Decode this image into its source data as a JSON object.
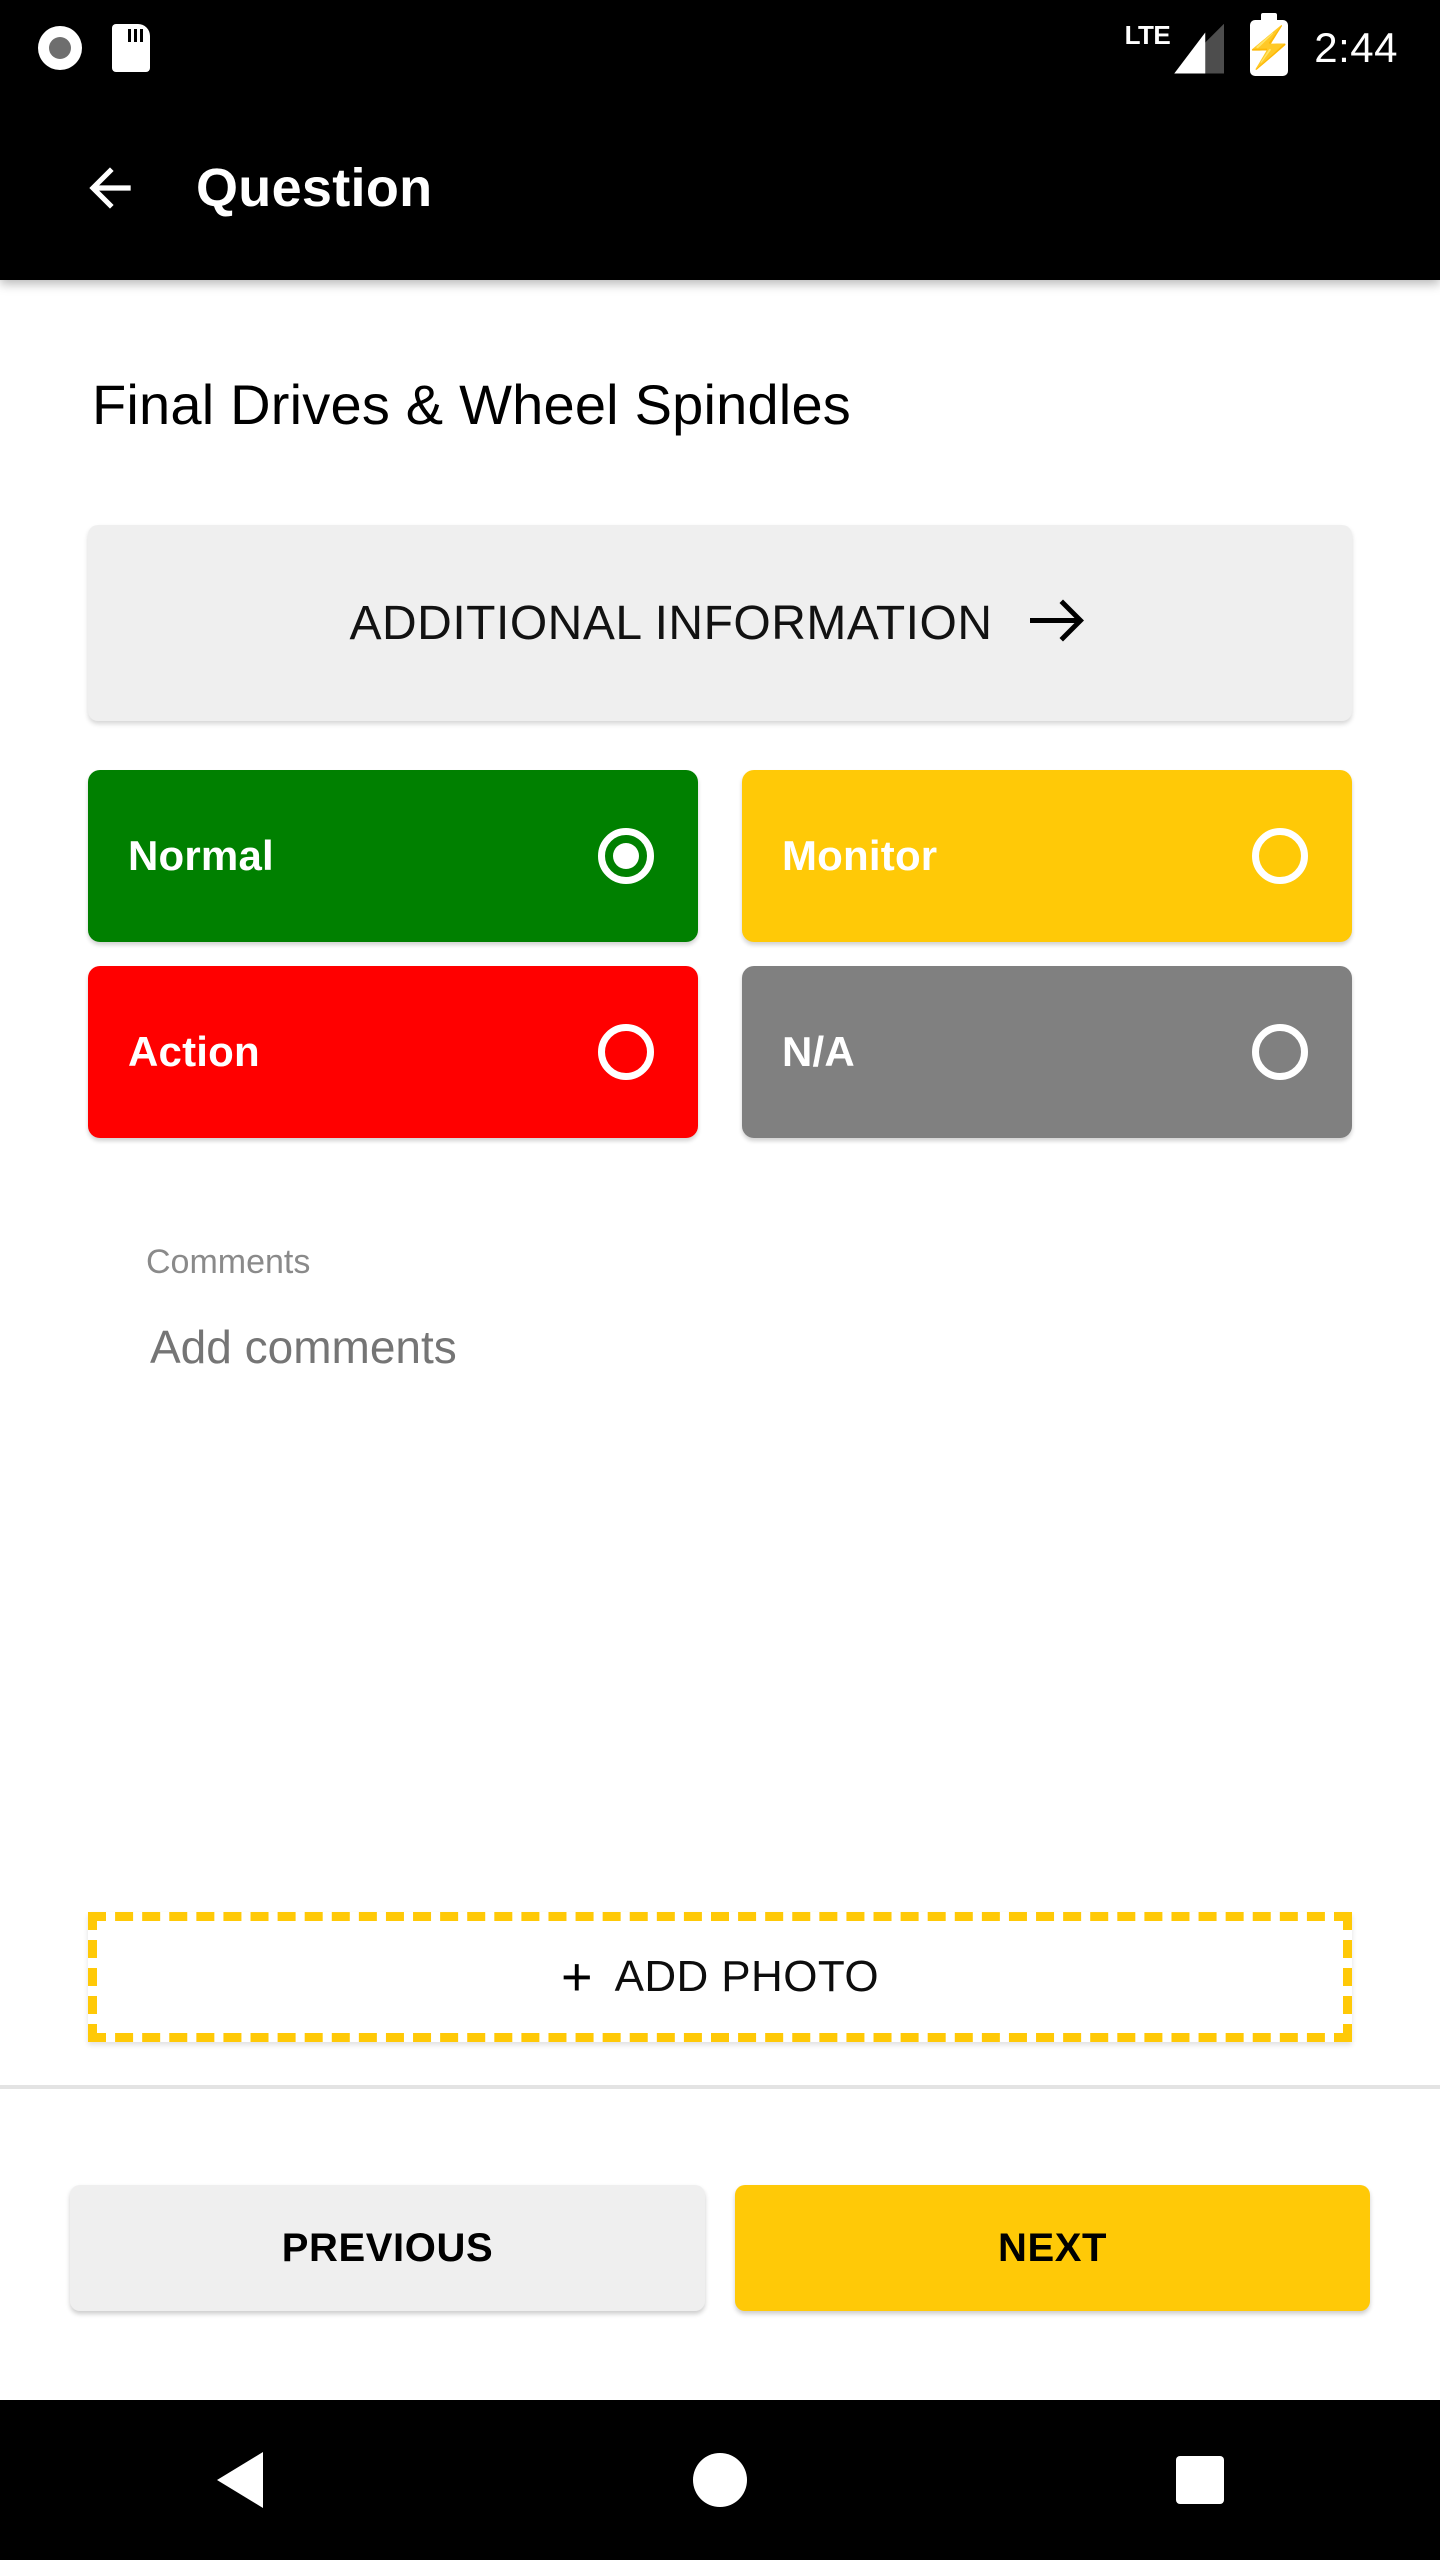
{
  "status_bar": {
    "icons": [
      "record-icon",
      "sdcard-icon"
    ],
    "network_label": "LTE",
    "battery_state": "charging",
    "time": "2:44"
  },
  "app_bar": {
    "back_icon": "arrow-left-icon",
    "title": "Question"
  },
  "main": {
    "page_title": "Final Drives & Wheel Spindles",
    "additional_information": {
      "label": "ADDITIONAL INFORMATION",
      "arrow_icon": "arrow-right-icon"
    },
    "options": [
      {
        "label": "Normal",
        "color": "#008000",
        "selected": true,
        "radio_icon": "radio-checked-icon"
      },
      {
        "label": "Monitor",
        "color": "#ffc907",
        "selected": false,
        "radio_icon": "radio-unchecked-icon"
      },
      {
        "label": "Action",
        "color": "#ff0000",
        "selected": false,
        "radio_icon": "radio-unchecked-icon"
      },
      {
        "label": "N/A",
        "color": "#808080",
        "selected": false,
        "radio_icon": "radio-unchecked-icon"
      }
    ],
    "comments": {
      "label": "Comments",
      "value": "",
      "placeholder": "Add comments"
    },
    "add_photo": {
      "plus_icon": "+",
      "label": "ADD PHOTO",
      "border_color": "#ffc907"
    }
  },
  "bottom_bar": {
    "previous_label": "PREVIOUS",
    "next_label": "NEXT",
    "next_color": "#ffc907",
    "previous_color": "#efefef"
  },
  "system_nav": {
    "back": "triangle-back-icon",
    "home": "circle-home-icon",
    "recents": "square-recents-icon"
  }
}
